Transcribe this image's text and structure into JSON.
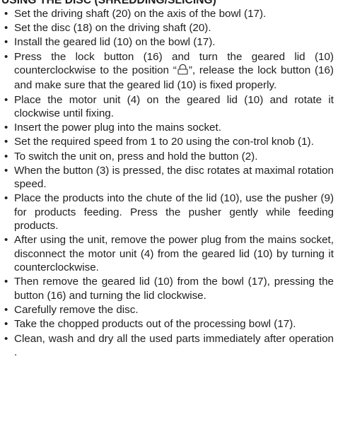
{
  "heading": "USING THE DISC (SHREDDING/SLICING)",
  "steps": [
    {
      "text": "Set the driving shaft (20) on the axis of the bowl (17)."
    },
    {
      "text": "Set the disc (18) on the driving shaft (20)."
    },
    {
      "text": "Install the geared lid (10) on the bowl (17)."
    },
    {
      "before": "Press the lock button (16) and turn the geared lid (10) counterclockwise to the position “",
      "icon": "lock-icon",
      "after": "”, release the lock button (16) and make sure that the geared lid (10) is fixed properly."
    },
    {
      "text": "Place the motor unit (4) on the geared lid (10) and rotate it clockwise until fixing."
    },
    {
      "text": "Insert the power plug into the mains socket."
    },
    {
      "text": "Set the required speed from 1 to 20 using the con-trol knob (1)."
    },
    {
      "text": "To switch the unit on, press and hold the button (2)."
    },
    {
      "text": "When the button (3) is pressed, the disc rotates at maximal rotation speed."
    },
    {
      "text": "Place the products into the chute of the lid (10), use the pusher (9) for products feeding. Press the pusher gently while feeding products."
    },
    {
      "text": "After using the unit, remove the power plug from the mains socket, disconnect the motor unit (4) from the geared lid (10) by turning it counterclockwise."
    },
    {
      "text": "Then remove the geared lid (10) from the bowl (17), pressing the button (16) and turning the lid clockwise."
    },
    {
      "text": "Carefully remove the disc."
    },
    {
      "text": "Take the chopped products out of the processing bowl (17)."
    },
    {
      "text": "Clean, wash and dry all the used parts immediately after operation ."
    }
  ],
  "bullet": "•"
}
